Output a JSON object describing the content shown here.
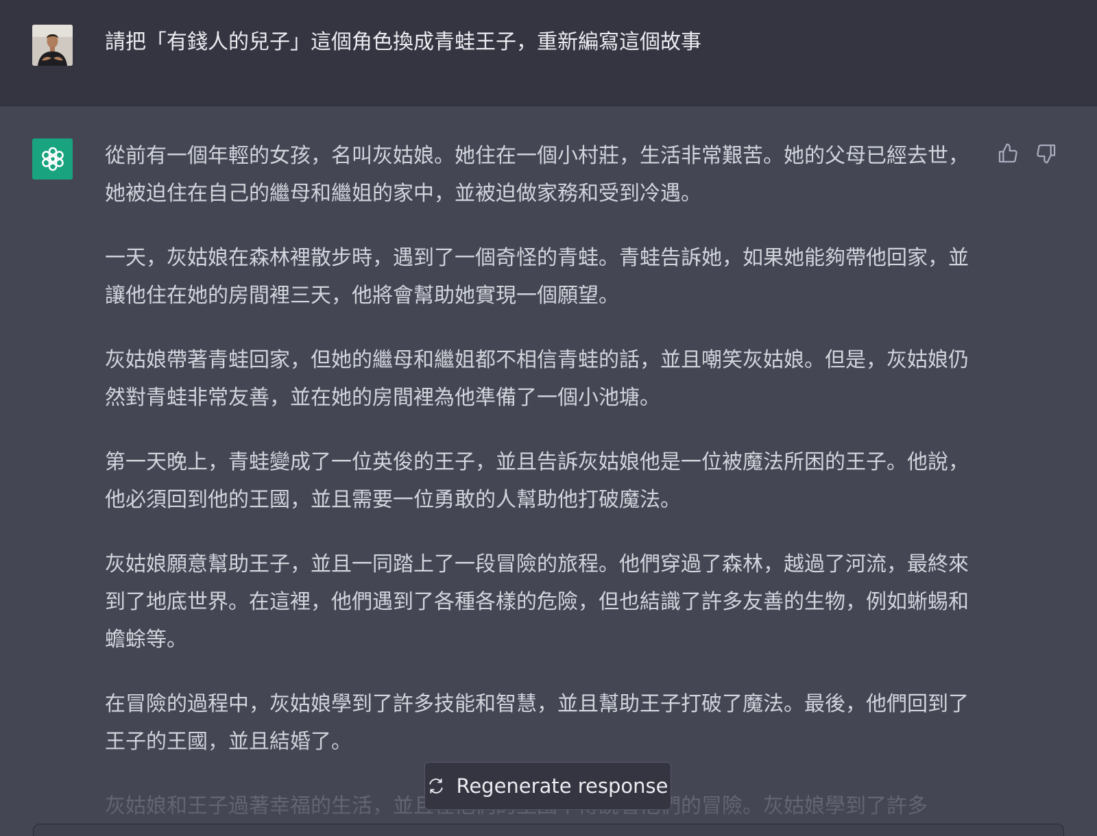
{
  "user_message": {
    "avatar": "user-photo-avatar",
    "text": "請把「有錢人的兒子」這個角色換成青蛙王子，重新編寫這個故事"
  },
  "assistant_message": {
    "avatar": "openai-logo-icon",
    "paragraphs": [
      "從前有一個年輕的女孩，名叫灰姑娘。她住在一個小村莊，生活非常艱苦。她的父母已經去世，她被迫住在自己的繼母和繼姐的家中，並被迫做家務和受到冷遇。",
      "一天，灰姑娘在森林裡散步時，遇到了一個奇怪的青蛙。青蛙告訴她，如果她能夠帶他回家，並讓他住在她的房間裡三天，他將會幫助她實現一個願望。",
      "灰姑娘帶著青蛙回家，但她的繼母和繼姐都不相信青蛙的話，並且嘲笑灰姑娘。但是，灰姑娘仍然對青蛙非常友善，並在她的房間裡為他準備了一個小池塘。",
      "第一天晚上，青蛙變成了一位英俊的王子，並且告訴灰姑娘他是一位被魔法所困的王子。他說，他必須回到他的王國，並且需要一位勇敢的人幫助他打破魔法。",
      "灰姑娘願意幫助王子，並且一同踏上了一段冒險的旅程。他們穿過了森林，越過了河流，最終來到了地底世界。在這裡，他們遇到了各種各樣的危險，但也結識了許多友善的生物，例如蜥蜴和蟾蜍等。",
      "在冒險的過程中，灰姑娘學到了許多技能和智慧，並且幫助王子打破了魔法。最後，他們回到了王子的王國，並且結婚了。",
      "灰姑娘和王子過著幸福的生活，並且在他們的王國中傳說著他們的冒險。灰姑娘學到了許多"
    ]
  },
  "feedback": {
    "thumbs_up_icon": "thumbs-up-icon",
    "thumbs_down_icon": "thumbs-down-icon"
  },
  "regenerate": {
    "label": "Regenerate response",
    "icon": "refresh-icon"
  },
  "colors": {
    "user_bg": "#343541",
    "assistant_bg": "#444654",
    "openai_green": "#19a37f",
    "text": "#d1d5db"
  }
}
